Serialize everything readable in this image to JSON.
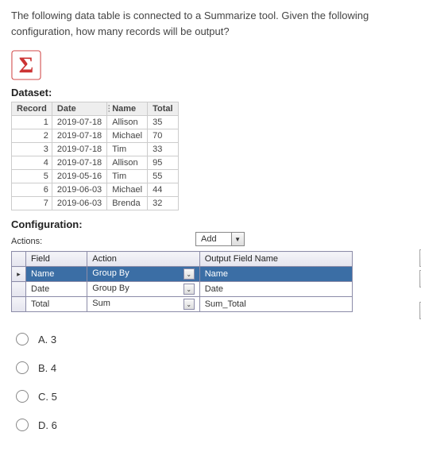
{
  "question": "The following data table is connected to a Summarize tool. Given the following configuration, how many records will be output?",
  "sigma_alt": "Summarize tool (sigma)",
  "dataset_label": "Dataset:",
  "dataset": {
    "columns": [
      "Record",
      "Date",
      "Name",
      "Total"
    ],
    "rows": [
      {
        "rec": "1",
        "date": "2019-07-18",
        "name": "Allison",
        "total": "35"
      },
      {
        "rec": "2",
        "date": "2019-07-18",
        "name": "Michael",
        "total": "70"
      },
      {
        "rec": "3",
        "date": "2019-07-18",
        "name": "Tim",
        "total": "33"
      },
      {
        "rec": "4",
        "date": "2019-07-18",
        "name": "Allison",
        "total": "95"
      },
      {
        "rec": "5",
        "date": "2019-05-16",
        "name": "Tim",
        "total": "55"
      },
      {
        "rec": "6",
        "date": "2019-06-03",
        "name": "Michael",
        "total": "44"
      },
      {
        "rec": "7",
        "date": "2019-06-03",
        "name": "Brenda",
        "total": "32"
      }
    ]
  },
  "config_label": "Configuration:",
  "actions_label": "Actions:",
  "add_label": "Add",
  "grid": {
    "headers": [
      "Field",
      "Action",
      "Output Field Name"
    ],
    "rows": [
      {
        "field": "Name",
        "action": "Group By",
        "output": "Name",
        "selected": true
      },
      {
        "field": "Date",
        "action": "Group By",
        "output": "Date",
        "selected": false
      },
      {
        "field": "Total",
        "action": "Sum",
        "output": "Sum_Total",
        "selected": false
      }
    ]
  },
  "side_buttons": {
    "up": "↑",
    "down": "↓",
    "delete": "⊝"
  },
  "options": [
    {
      "key": "A",
      "text": "A. 3"
    },
    {
      "key": "B",
      "text": "B. 4"
    },
    {
      "key": "C",
      "text": "C. 5"
    },
    {
      "key": "D",
      "text": "D. 6"
    }
  ]
}
